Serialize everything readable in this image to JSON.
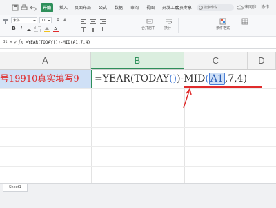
{
  "ribbon": {
    "tabs": [
      {
        "label": "开始",
        "active": true
      },
      {
        "label": "插入"
      },
      {
        "label": "页面布局"
      },
      {
        "label": "公式"
      },
      {
        "label": "数据"
      },
      {
        "label": "审阅"
      },
      {
        "label": "视图"
      },
      {
        "label": "开发工具"
      },
      {
        "label": "会员专享"
      }
    ],
    "search_placeholder": "搜索命令",
    "sync_label": "未同步",
    "collab_label": "协作",
    "font_name": "宋体",
    "font_size": "11",
    "condition_label": "条件格式",
    "wrap_label": "换行",
    "merge_label": "合并居中"
  },
  "formula_bar": {
    "cell_ref": "B1",
    "cancel_glyph": "✕",
    "confirm_glyph": "✓",
    "fx_label": "fx",
    "formula": "=YEAR(TODAY())-MID(A1,7,4)"
  },
  "grid": {
    "columns": [
      "A",
      "B",
      "C",
      "D"
    ],
    "active_column": "B",
    "a1_value": "号19910真实填写9",
    "b1_edit": {
      "prefix": "=YEAR",
      "open1": "(",
      "today": "TODAY",
      "inner_parens": "()",
      "close1": ")",
      "mid": "-MID",
      "open2": "(",
      "ref": "A1",
      "rest": ",7,4)"
    }
  },
  "sheets": {
    "tabs": [
      "Sheet1"
    ]
  },
  "colors": {
    "accent": "#2e8f5a",
    "annotation": "#e02b2b",
    "reference_blue": "#4a7fd6"
  }
}
